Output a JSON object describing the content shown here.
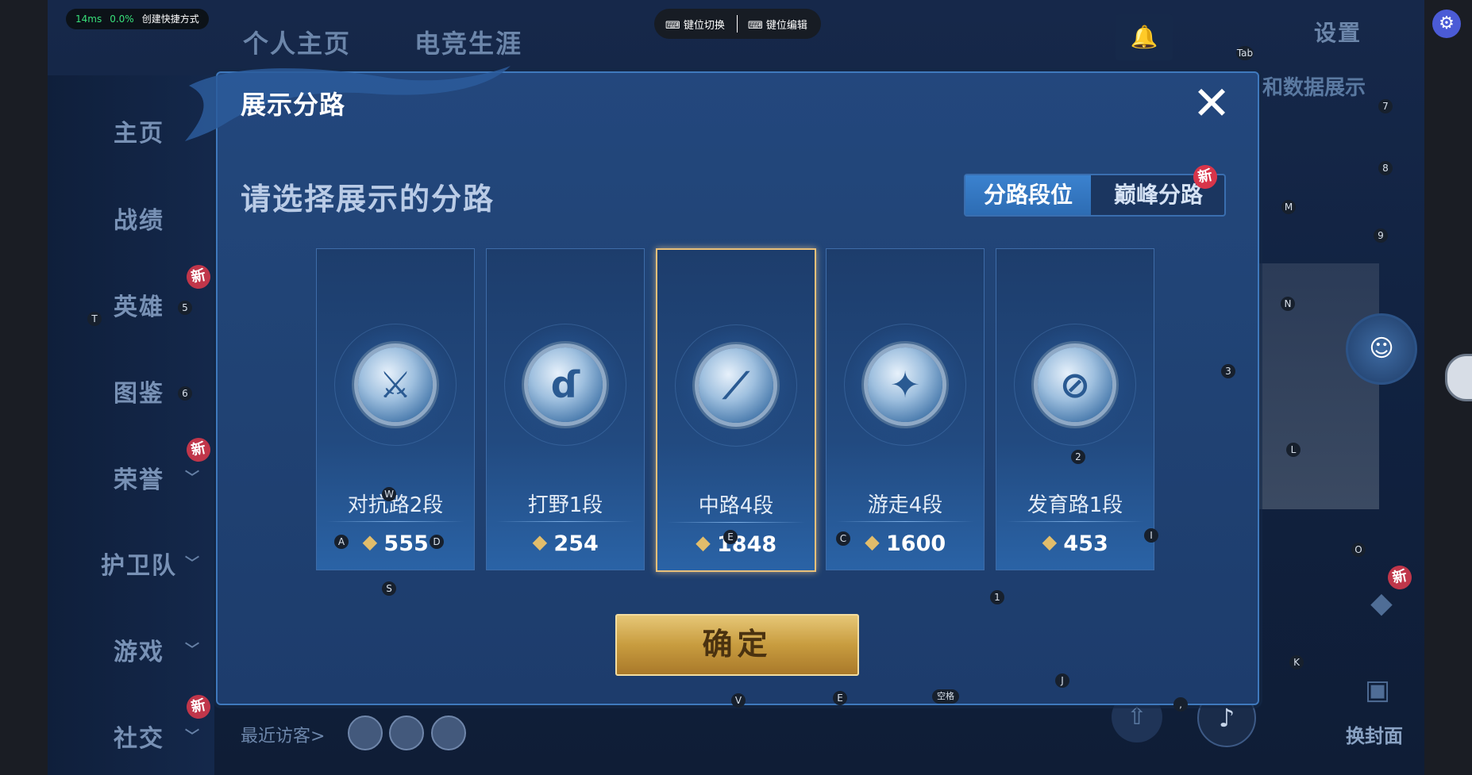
{
  "status": {
    "ping": "14ms",
    "loss": "0.0%",
    "shortcut": "创建快捷方式"
  },
  "keymap": {
    "switch": "键位切换",
    "edit": "键位编辑"
  },
  "settings_icon": "gear-icon",
  "background": {
    "top_tabs": [
      "个人主页",
      "电竞生涯"
    ],
    "settings_label": "设置",
    "data_text": "和数据展示",
    "nav": [
      {
        "label": "主页",
        "badge": ""
      },
      {
        "label": "战绩",
        "badge": ""
      },
      {
        "label": "英雄",
        "badge": "新"
      },
      {
        "label": "图鉴",
        "badge": ""
      },
      {
        "label": "荣誉",
        "badge": "新"
      },
      {
        "label": "护卫队",
        "badge": ""
      },
      {
        "label": "游戏",
        "badge": ""
      },
      {
        "label": "社交",
        "badge": "新"
      }
    ],
    "visitors": "最近访客>",
    "change_cover": "换封面",
    "right_new": "新"
  },
  "dialog": {
    "title": "展示分路",
    "close_icon": "close-icon",
    "subtitle": "请选择展示的分路",
    "tabs": {
      "active": "分路段位",
      "inactive": "巅峰分路",
      "badge": "新"
    },
    "confirm": "确定",
    "cards": [
      {
        "name": "对抗路2段",
        "score": "555",
        "icon": "sword-shield-icon",
        "selected": false
      },
      {
        "name": "打野1段",
        "score": "254",
        "icon": "dragon-icon",
        "selected": false
      },
      {
        "name": "中路4段",
        "score": "1848",
        "icon": "staff-icon",
        "selected": true
      },
      {
        "name": "游走4段",
        "score": "1600",
        "icon": "wings-icon",
        "selected": false
      },
      {
        "name": "发育路1段",
        "score": "453",
        "icon": "crosshair-icon",
        "selected": false
      }
    ]
  },
  "keys": [
    "Tab",
    "7",
    "8",
    "M",
    "9",
    "N",
    "5",
    "T",
    "6",
    "3",
    "2",
    "L",
    "W",
    "A",
    "D",
    "E",
    "C",
    "I",
    "O",
    "S",
    "1",
    "K",
    "J",
    "V",
    "E",
    "空格",
    ","
  ]
}
